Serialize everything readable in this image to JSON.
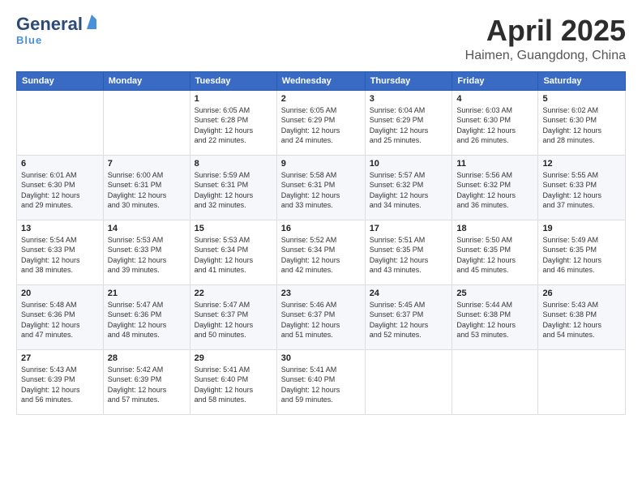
{
  "header": {
    "logo_general": "General",
    "logo_blue": "Blue",
    "title": "April 2025",
    "location": "Haimen, Guangdong, China"
  },
  "weekdays": [
    "Sunday",
    "Monday",
    "Tuesday",
    "Wednesday",
    "Thursday",
    "Friday",
    "Saturday"
  ],
  "weeks": [
    [
      {
        "day": "",
        "info": ""
      },
      {
        "day": "",
        "info": ""
      },
      {
        "day": "1",
        "info": "Sunrise: 6:05 AM\nSunset: 6:28 PM\nDaylight: 12 hours\nand 22 minutes."
      },
      {
        "day": "2",
        "info": "Sunrise: 6:05 AM\nSunset: 6:29 PM\nDaylight: 12 hours\nand 24 minutes."
      },
      {
        "day": "3",
        "info": "Sunrise: 6:04 AM\nSunset: 6:29 PM\nDaylight: 12 hours\nand 25 minutes."
      },
      {
        "day": "4",
        "info": "Sunrise: 6:03 AM\nSunset: 6:30 PM\nDaylight: 12 hours\nand 26 minutes."
      },
      {
        "day": "5",
        "info": "Sunrise: 6:02 AM\nSunset: 6:30 PM\nDaylight: 12 hours\nand 28 minutes."
      }
    ],
    [
      {
        "day": "6",
        "info": "Sunrise: 6:01 AM\nSunset: 6:30 PM\nDaylight: 12 hours\nand 29 minutes."
      },
      {
        "day": "7",
        "info": "Sunrise: 6:00 AM\nSunset: 6:31 PM\nDaylight: 12 hours\nand 30 minutes."
      },
      {
        "day": "8",
        "info": "Sunrise: 5:59 AM\nSunset: 6:31 PM\nDaylight: 12 hours\nand 32 minutes."
      },
      {
        "day": "9",
        "info": "Sunrise: 5:58 AM\nSunset: 6:31 PM\nDaylight: 12 hours\nand 33 minutes."
      },
      {
        "day": "10",
        "info": "Sunrise: 5:57 AM\nSunset: 6:32 PM\nDaylight: 12 hours\nand 34 minutes."
      },
      {
        "day": "11",
        "info": "Sunrise: 5:56 AM\nSunset: 6:32 PM\nDaylight: 12 hours\nand 36 minutes."
      },
      {
        "day": "12",
        "info": "Sunrise: 5:55 AM\nSunset: 6:33 PM\nDaylight: 12 hours\nand 37 minutes."
      }
    ],
    [
      {
        "day": "13",
        "info": "Sunrise: 5:54 AM\nSunset: 6:33 PM\nDaylight: 12 hours\nand 38 minutes."
      },
      {
        "day": "14",
        "info": "Sunrise: 5:53 AM\nSunset: 6:33 PM\nDaylight: 12 hours\nand 39 minutes."
      },
      {
        "day": "15",
        "info": "Sunrise: 5:53 AM\nSunset: 6:34 PM\nDaylight: 12 hours\nand 41 minutes."
      },
      {
        "day": "16",
        "info": "Sunrise: 5:52 AM\nSunset: 6:34 PM\nDaylight: 12 hours\nand 42 minutes."
      },
      {
        "day": "17",
        "info": "Sunrise: 5:51 AM\nSunset: 6:35 PM\nDaylight: 12 hours\nand 43 minutes."
      },
      {
        "day": "18",
        "info": "Sunrise: 5:50 AM\nSunset: 6:35 PM\nDaylight: 12 hours\nand 45 minutes."
      },
      {
        "day": "19",
        "info": "Sunrise: 5:49 AM\nSunset: 6:35 PM\nDaylight: 12 hours\nand 46 minutes."
      }
    ],
    [
      {
        "day": "20",
        "info": "Sunrise: 5:48 AM\nSunset: 6:36 PM\nDaylight: 12 hours\nand 47 minutes."
      },
      {
        "day": "21",
        "info": "Sunrise: 5:47 AM\nSunset: 6:36 PM\nDaylight: 12 hours\nand 48 minutes."
      },
      {
        "day": "22",
        "info": "Sunrise: 5:47 AM\nSunset: 6:37 PM\nDaylight: 12 hours\nand 50 minutes."
      },
      {
        "day": "23",
        "info": "Sunrise: 5:46 AM\nSunset: 6:37 PM\nDaylight: 12 hours\nand 51 minutes."
      },
      {
        "day": "24",
        "info": "Sunrise: 5:45 AM\nSunset: 6:37 PM\nDaylight: 12 hours\nand 52 minutes."
      },
      {
        "day": "25",
        "info": "Sunrise: 5:44 AM\nSunset: 6:38 PM\nDaylight: 12 hours\nand 53 minutes."
      },
      {
        "day": "26",
        "info": "Sunrise: 5:43 AM\nSunset: 6:38 PM\nDaylight: 12 hours\nand 54 minutes."
      }
    ],
    [
      {
        "day": "27",
        "info": "Sunrise: 5:43 AM\nSunset: 6:39 PM\nDaylight: 12 hours\nand 56 minutes."
      },
      {
        "day": "28",
        "info": "Sunrise: 5:42 AM\nSunset: 6:39 PM\nDaylight: 12 hours\nand 57 minutes."
      },
      {
        "day": "29",
        "info": "Sunrise: 5:41 AM\nSunset: 6:40 PM\nDaylight: 12 hours\nand 58 minutes."
      },
      {
        "day": "30",
        "info": "Sunrise: 5:41 AM\nSunset: 6:40 PM\nDaylight: 12 hours\nand 59 minutes."
      },
      {
        "day": "",
        "info": ""
      },
      {
        "day": "",
        "info": ""
      },
      {
        "day": "",
        "info": ""
      }
    ]
  ]
}
